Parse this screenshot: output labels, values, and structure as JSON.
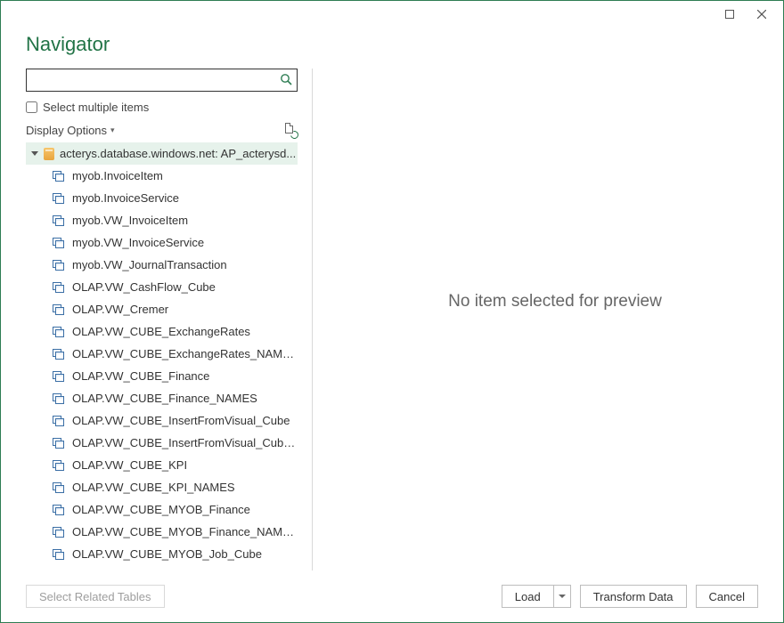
{
  "window": {
    "title": "Navigator"
  },
  "search": {
    "value": "",
    "placeholder": ""
  },
  "multi_select": {
    "label": "Select multiple items",
    "checked": false
  },
  "display_options_label": "Display Options",
  "tree": {
    "root_label": "acterys.database.windows.net: AP_acterysd...",
    "items": [
      {
        "label": "myob.InvoiceItem"
      },
      {
        "label": "myob.InvoiceService"
      },
      {
        "label": "myob.VW_InvoiceItem"
      },
      {
        "label": "myob.VW_InvoiceService"
      },
      {
        "label": "myob.VW_JournalTransaction"
      },
      {
        "label": "OLAP.VW_CashFlow_Cube"
      },
      {
        "label": "OLAP.VW_Cremer"
      },
      {
        "label": "OLAP.VW_CUBE_ExchangeRates"
      },
      {
        "label": "OLAP.VW_CUBE_ExchangeRates_NAMES"
      },
      {
        "label": "OLAP.VW_CUBE_Finance"
      },
      {
        "label": "OLAP.VW_CUBE_Finance_NAMES"
      },
      {
        "label": "OLAP.VW_CUBE_InsertFromVisual_Cube"
      },
      {
        "label": "OLAP.VW_CUBE_InsertFromVisual_Cube_..."
      },
      {
        "label": "OLAP.VW_CUBE_KPI"
      },
      {
        "label": "OLAP.VW_CUBE_KPI_NAMES"
      },
      {
        "label": "OLAP.VW_CUBE_MYOB_Finance"
      },
      {
        "label": "OLAP.VW_CUBE_MYOB_Finance_NAMES"
      },
      {
        "label": "OLAP.VW_CUBE_MYOB_Job_Cube"
      }
    ]
  },
  "preview": {
    "empty_text": "No item selected for preview"
  },
  "footer": {
    "select_related": "Select Related Tables",
    "load": "Load",
    "transform": "Transform Data",
    "cancel": "Cancel"
  }
}
